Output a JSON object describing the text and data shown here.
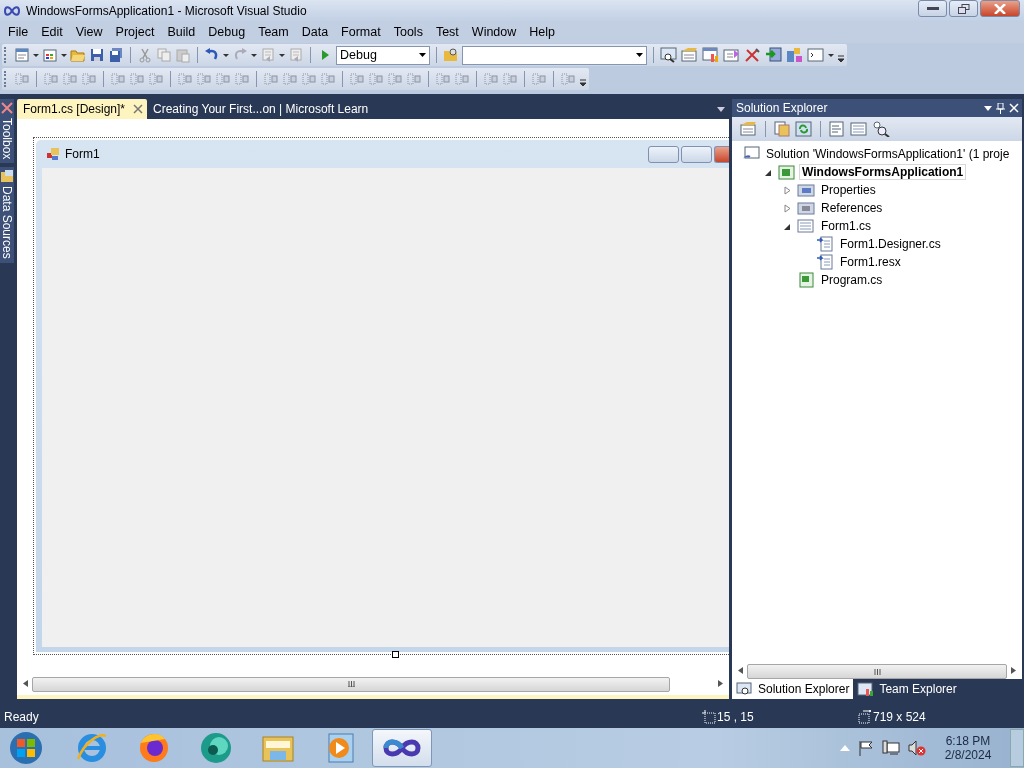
{
  "window": {
    "title": "WindowsFormsApplication1 - Microsoft Visual Studio"
  },
  "menu": [
    {
      "label": "File"
    },
    {
      "label": "Edit"
    },
    {
      "label": "View"
    },
    {
      "label": "Project"
    },
    {
      "label": "Build"
    },
    {
      "label": "Debug"
    },
    {
      "label": "Team"
    },
    {
      "label": "Data"
    },
    {
      "label": "Format"
    },
    {
      "label": "Tools"
    },
    {
      "label": "Test"
    },
    {
      "label": "Window"
    },
    {
      "label": "Help"
    }
  ],
  "toolbar": {
    "configuration": "Debug"
  },
  "side_tabs": [
    {
      "label": "Toolbox",
      "kind": "tools"
    },
    {
      "label": "Data Sources",
      "kind": "data"
    }
  ],
  "document_tabs": [
    {
      "label": "Form1.cs [Design]*",
      "selected": true
    },
    {
      "label": "Creating Your First...on | Microsoft Learn",
      "selected": false
    }
  ],
  "form": {
    "title": "Form1"
  },
  "solution_explorer": {
    "title": "Solution Explorer",
    "tree": [
      {
        "label": "Solution 'WindowsFormsApplication1' (1 proje",
        "kind": "solution",
        "selected": false,
        "children": [
          {
            "label": "WindowsFormsApplication1",
            "kind": "project",
            "selected": true,
            "expanded": true,
            "children": [
              {
                "label": "Properties",
                "kind": "properties",
                "selected": false,
                "expanded": false
              },
              {
                "label": "References",
                "kind": "references",
                "selected": false,
                "expanded": false
              },
              {
                "label": "Form1.cs",
                "kind": "form",
                "selected": false,
                "expanded": true,
                "children": [
                  {
                    "label": "Form1.Designer.cs",
                    "kind": "generated",
                    "selected": false
                  },
                  {
                    "label": "Form1.resx",
                    "kind": "generated",
                    "selected": false
                  }
                ]
              },
              {
                "label": "Program.cs",
                "kind": "code",
                "selected": false
              }
            ]
          }
        ]
      }
    ]
  },
  "panel_tabs": [
    {
      "label": "Solution Explorer",
      "selected": true,
      "kind": "solution"
    },
    {
      "label": "Team Explorer",
      "selected": false,
      "kind": "team"
    }
  ],
  "status_bar": {
    "text": "Ready",
    "position": "15 , 15",
    "size": "719 x 524"
  },
  "taskbar": {
    "apps": [
      {
        "kind": "ie",
        "selected": false
      },
      {
        "kind": "firefox",
        "selected": false
      },
      {
        "kind": "orb",
        "selected": false
      },
      {
        "kind": "explorer",
        "selected": false
      },
      {
        "kind": "media",
        "selected": false
      },
      {
        "kind": "vs",
        "selected": true
      }
    ],
    "time": "6:18 PM",
    "date": "2/8/2024"
  }
}
